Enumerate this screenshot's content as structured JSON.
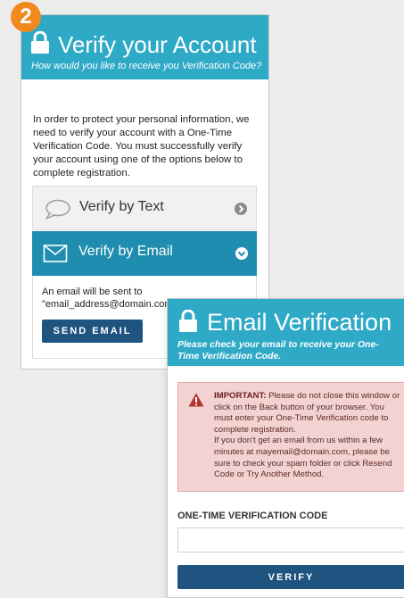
{
  "step_badge": "2",
  "verify_account": {
    "title": "Verify your Account",
    "subtitle": "How would you like to receive you Verification Code?",
    "intro": "In order to protect your personal information, we need to verify your account with a One-Time Verification Code. You must successfully verify your account using one of the options below to complete registration.",
    "options": [
      {
        "label": "Verify by Text",
        "icon": "speech-bubble-icon",
        "state": "collapsed"
      },
      {
        "label": "Verify by Email",
        "icon": "envelope-icon",
        "state": "expanded"
      }
    ],
    "email_note_line1": "An email will be sent to",
    "email_note_line2": "\"email_address@domain.com\"",
    "send_button": "SEND EMAIL"
  },
  "email_verification": {
    "title": "Email Verification",
    "subtitle": "Please check your email to receive your One-Time Verification Code.",
    "alert_strong": "IMPORTANT:",
    "alert_line1": " Please do not close this window or click on the Back button of your browser. You must enter your One-Time Verification code to complete registration.",
    "alert_line2": "If you don't get an email from us within a few minutes at mayemail@domain.com, please be sure to check your spam folder or click Resend Code or Try Another Method.",
    "code_label": "ONE-TIME VERIFICATION CODE",
    "code_value": "",
    "verify_button": "VERIFY"
  },
  "colors": {
    "header": "#2ea9c6",
    "selected_option": "#1e8db0",
    "button": "#1f5480",
    "badge": "#f08a1c",
    "alert_bg": "#f3d3d1",
    "warning_icon": "#b3332d"
  }
}
